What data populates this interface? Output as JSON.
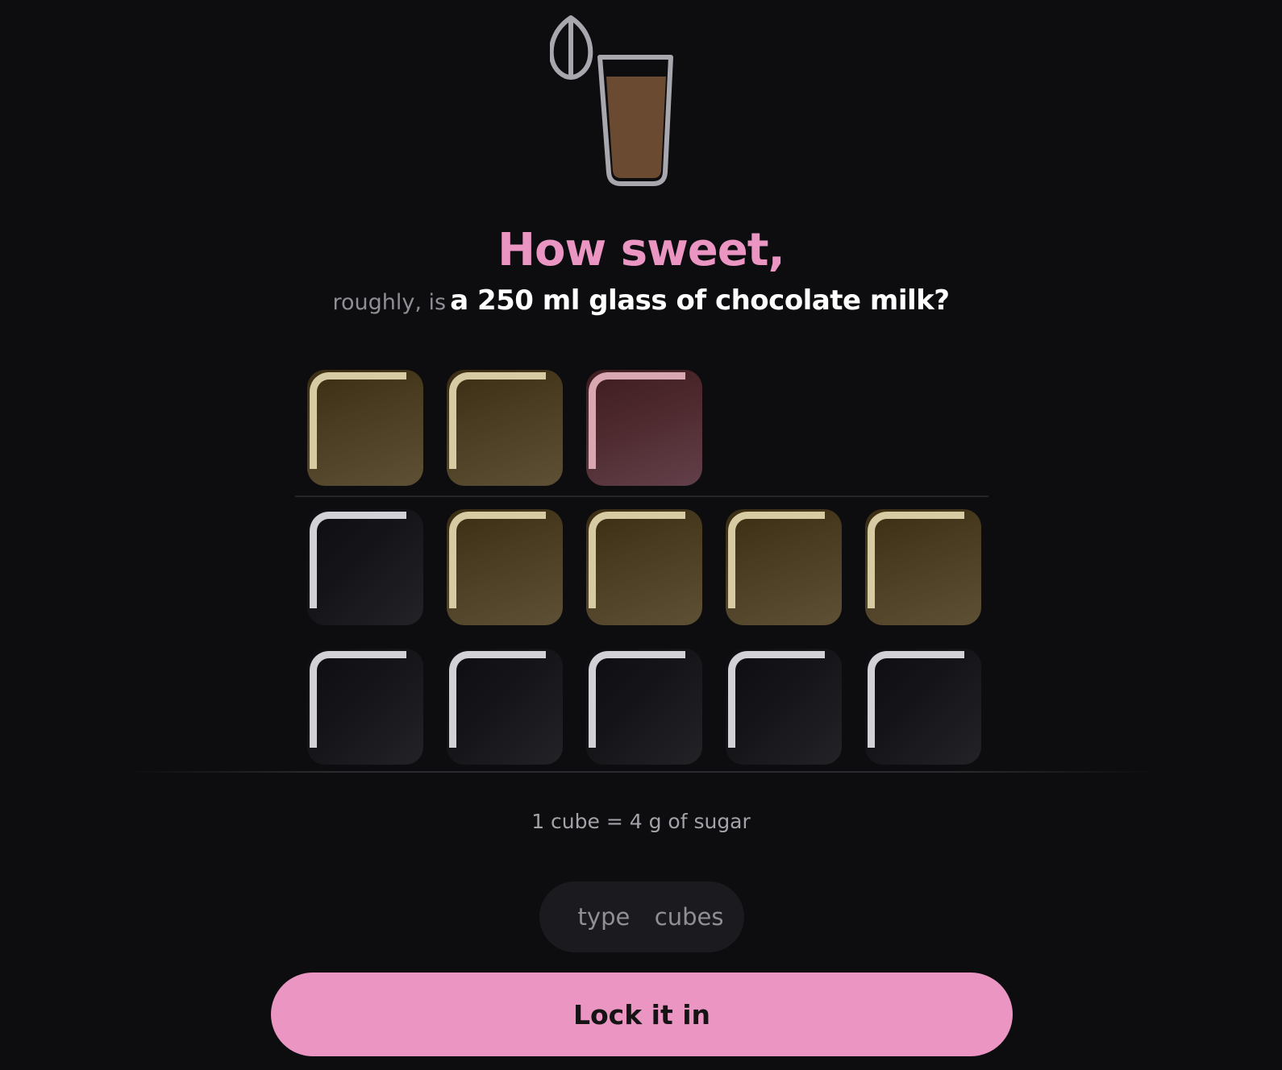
{
  "header": {
    "title": "How sweet,",
    "question_prefix": "roughly, is",
    "question_main": "a 250 ml glass of chocolate milk?"
  },
  "illustration": {
    "icon": "chocolate-milk-glass-with-leaf-icon",
    "glass_outline_color": "#a7a7ad",
    "drink_color": "#6b4a32"
  },
  "cube_grid": {
    "rows": [
      [
        "filled",
        "filled",
        "over"
      ],
      [
        "empty",
        "filled",
        "filled",
        "filled",
        "filled"
      ],
      [
        "empty",
        "empty",
        "empty",
        "empty",
        "empty"
      ]
    ],
    "colors": {
      "filled": "#4a3c20",
      "over": "#4e2a2f",
      "empty": "#141418"
    }
  },
  "legend": "1 cube = 4 g of sugar",
  "input": {
    "placeholder": "type  cubes",
    "value": ""
  },
  "submit": {
    "label": "Lock it in"
  },
  "colors": {
    "accent": "#eb95c3",
    "background": "#0d0d10"
  }
}
